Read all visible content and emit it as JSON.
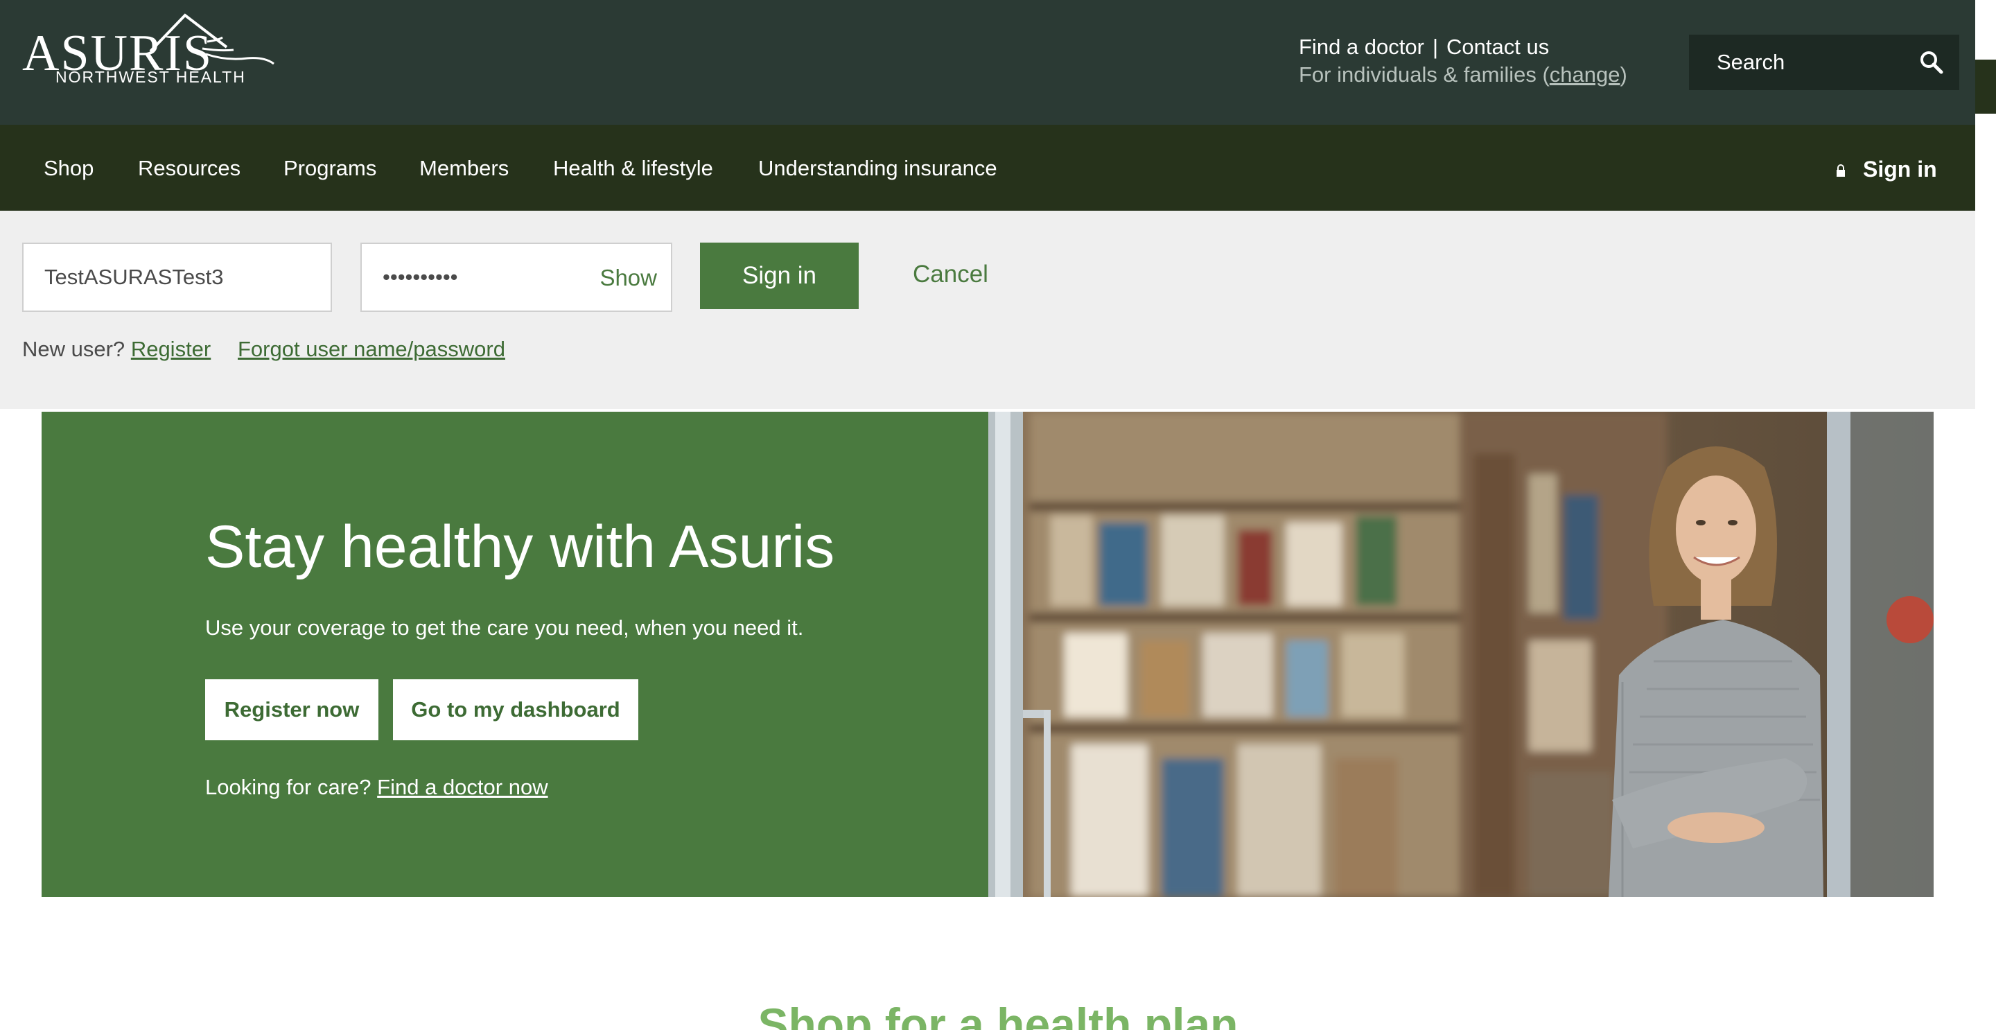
{
  "brand": {
    "name": "ASURIS",
    "tagline": "NORTHWEST HEALTH"
  },
  "utility": {
    "find_doctor": "Find a doctor",
    "separator": "|",
    "contact_us": "Contact us",
    "audience_prefix": "For individuals & families (",
    "audience_change": "change",
    "audience_suffix": ")"
  },
  "search": {
    "placeholder": "Search"
  },
  "nav": {
    "items": [
      {
        "label": "Shop"
      },
      {
        "label": "Resources"
      },
      {
        "label": "Programs"
      },
      {
        "label": "Members"
      },
      {
        "label": "Health & lifestyle"
      },
      {
        "label": "Understanding insurance"
      }
    ],
    "signin": "Sign in"
  },
  "signin_form": {
    "username_value": "TestASURASTest3",
    "password_value": "••••••••••",
    "show_label": "Show",
    "submit_label": "Sign in",
    "cancel_label": "Cancel",
    "new_user_text": "New user?",
    "register_label": "Register",
    "forgot_label": "Forgot user name/password"
  },
  "hero": {
    "title": "Stay healthy with Asuris",
    "subtitle": "Use your coverage to get the care you need, when you need it.",
    "register_btn": "Register now",
    "dashboard_btn": "Go to my dashboard",
    "care_text": "Looking for care?",
    "care_link": "Find a doctor now"
  },
  "section": {
    "title": "Shop for a health plan"
  },
  "colors": {
    "header": "#2b3a34",
    "nav": "#26321b",
    "primary_green": "#4a7a3f",
    "light_green": "#7bb565",
    "panel_bg": "#efefef"
  }
}
